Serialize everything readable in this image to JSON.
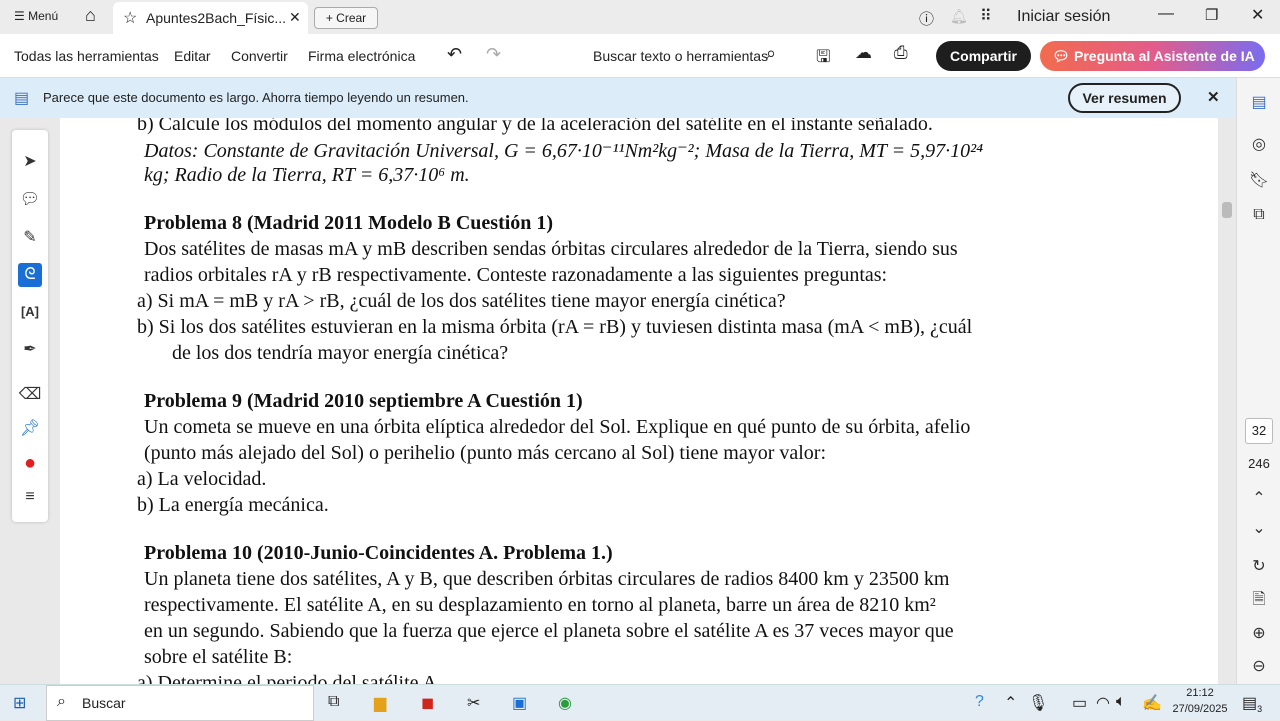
{
  "titlebar": {
    "menu": "Menú",
    "tab_title": "Apuntes2Bach_Físic...",
    "create": "Crear",
    "signin": "Iniciar sesión"
  },
  "toolbar": {
    "all_tools": "Todas las herramientas",
    "edit": "Editar",
    "convert": "Convertir",
    "esign": "Firma electrónica",
    "search": "Buscar texto o herramientas",
    "share": "Compartir",
    "ai": "Pregunta al Asistente de IA"
  },
  "banner": {
    "text": "Parece que este documento es largo. Ahorra tiempo leyendo un resumen.",
    "button": "Ver resumen"
  },
  "document": {
    "lines": [
      "b)   Calcule los módulos del momento angular y de la aceleración del satélite en el instante señalado.",
      "Datos: Constante de Gravitación Universal, G = 6,67·10⁻¹¹Nm²kg⁻²; Masa de la Tierra, MT = 5,97·10²⁴",
      "kg; Radio de la Tierra, RT = 6,37·10⁶ m.",
      "Problema 8 (Madrid 2011 Modelo B Cuestión 1)",
      "Dos satélites de masas mA y mB describen sendas órbitas circulares alrededor de la Tierra, siendo sus",
      "radios orbitales rA y rB respectivamente. Conteste razonadamente a las siguientes preguntas:",
      "a)   Si mA = mB y rA > rB, ¿cuál de los dos satélites tiene mayor energía cinética?",
      "b)   Si los dos satélites estuvieran en la misma órbita (rA = rB) y tuviesen distinta masa (mA < mB), ¿cuál",
      "de los dos tendría mayor energía cinética?",
      "Problema 9 (Madrid 2010 septiembre A Cuestión 1)",
      "Un cometa se mueve en una órbita elíptica alrededor del Sol. Explique en qué punto de su órbita, afelio",
      "(punto más alejado del Sol) o perihelio (punto más cercano al Sol) tiene mayor valor:",
      "a)   La velocidad.",
      "b)   La energía mecánica.",
      "Problema 10 (2010-Junio-Coincidentes A. Problema 1.)",
      "Un planeta tiene dos satélites, A y B, que describen órbitas circulares de radios 8400 km y 23500 km",
      "respectivamente. El satélite A, en su desplazamiento en torno al planeta, barre un área de 8210 km²",
      "en un segundo. Sabiendo que la fuerza que ejerce el planeta sobre el satélite A es 37 veces mayor que",
      "sobre el satélite B:",
      "a)   Determine el periodo del satélite A."
    ]
  },
  "pages": {
    "current": "32",
    "total": "246"
  },
  "taskbar": {
    "search": "Buscar",
    "time": "21:12",
    "date": "27/09/2025",
    "notifications": "3"
  }
}
